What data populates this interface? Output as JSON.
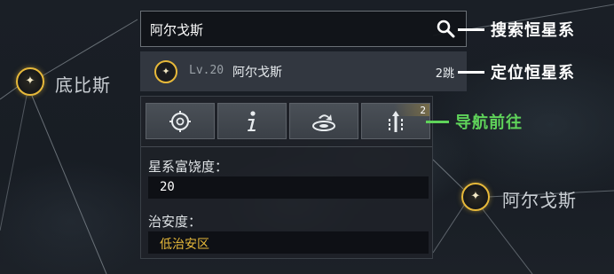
{
  "map": {
    "stars": [
      {
        "label": "底比斯"
      },
      {
        "label": "阿尔戈斯"
      }
    ]
  },
  "search": {
    "value": "阿尔戈斯",
    "icon": "search-icon"
  },
  "result": {
    "level": "Lv.20",
    "name": "阿尔戈斯",
    "jumps": "2跳"
  },
  "actions": [
    {
      "icon": "locate-icon"
    },
    {
      "icon": "info-icon"
    },
    {
      "icon": "warp-icon"
    },
    {
      "icon": "jump-route-icon",
      "badge": "2"
    }
  ],
  "fields": {
    "richness_label": "星系富饶度：",
    "richness_value": "20",
    "security_label": "治安度：",
    "security_value": "低治安区"
  },
  "callouts": {
    "search": "搜索恒星系",
    "locate": "定位恒星系",
    "navigate": "导航前往"
  },
  "colors": {
    "accent_gold": "#e7b93a",
    "security_text": "#e7b93a",
    "navigate_green": "#5fd35a",
    "callout_white": "#ffffff"
  }
}
